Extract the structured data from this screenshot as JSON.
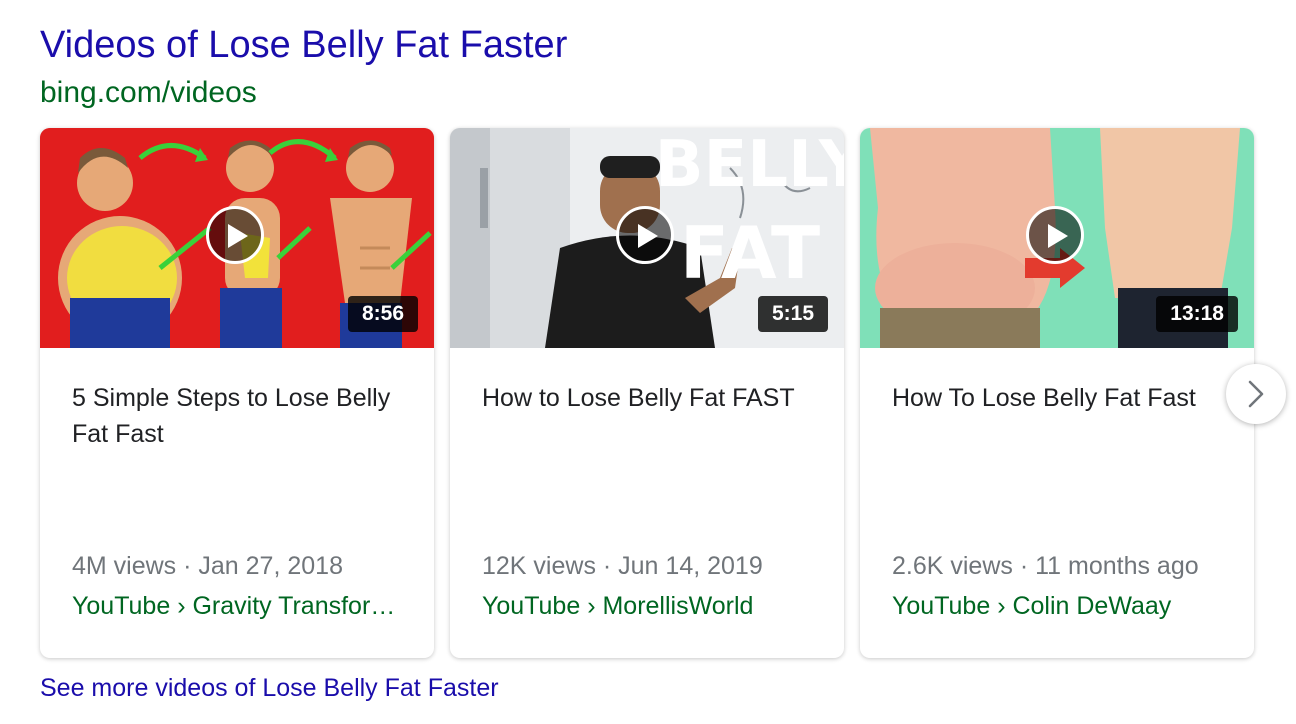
{
  "header": {
    "title": "Videos of Lose Belly Fat Faster",
    "source": "bing.com/videos"
  },
  "videos": [
    {
      "title": "5 Simple Steps to Lose Belly Fat Fast",
      "duration": "8:56",
      "meta": "4M views · Jan 27, 2018",
      "channel": "YouTube › Gravity Transformation - Fat Loss Experts"
    },
    {
      "title": "How to Lose Belly Fat FAST",
      "duration": "5:15",
      "meta": "12K views · Jun 14, 2019",
      "channel": "YouTube › MorellisWorld",
      "thumb_text": [
        "BELLY",
        "FAT"
      ]
    },
    {
      "title": "How To Lose Belly Fat Fast",
      "duration": "13:18",
      "meta": "2.6K views · 11 months ago",
      "channel": "YouTube › Colin DeWaay"
    }
  ],
  "footer": {
    "see_more": "See more videos of Lose Belly Fat Faster"
  },
  "colors": {
    "link": "#1a0dab",
    "url_green": "#006621",
    "meta_gray": "#70757a",
    "title_text": "#202124"
  },
  "icons": {
    "play": "play-icon",
    "next": "chevron-right-icon"
  }
}
